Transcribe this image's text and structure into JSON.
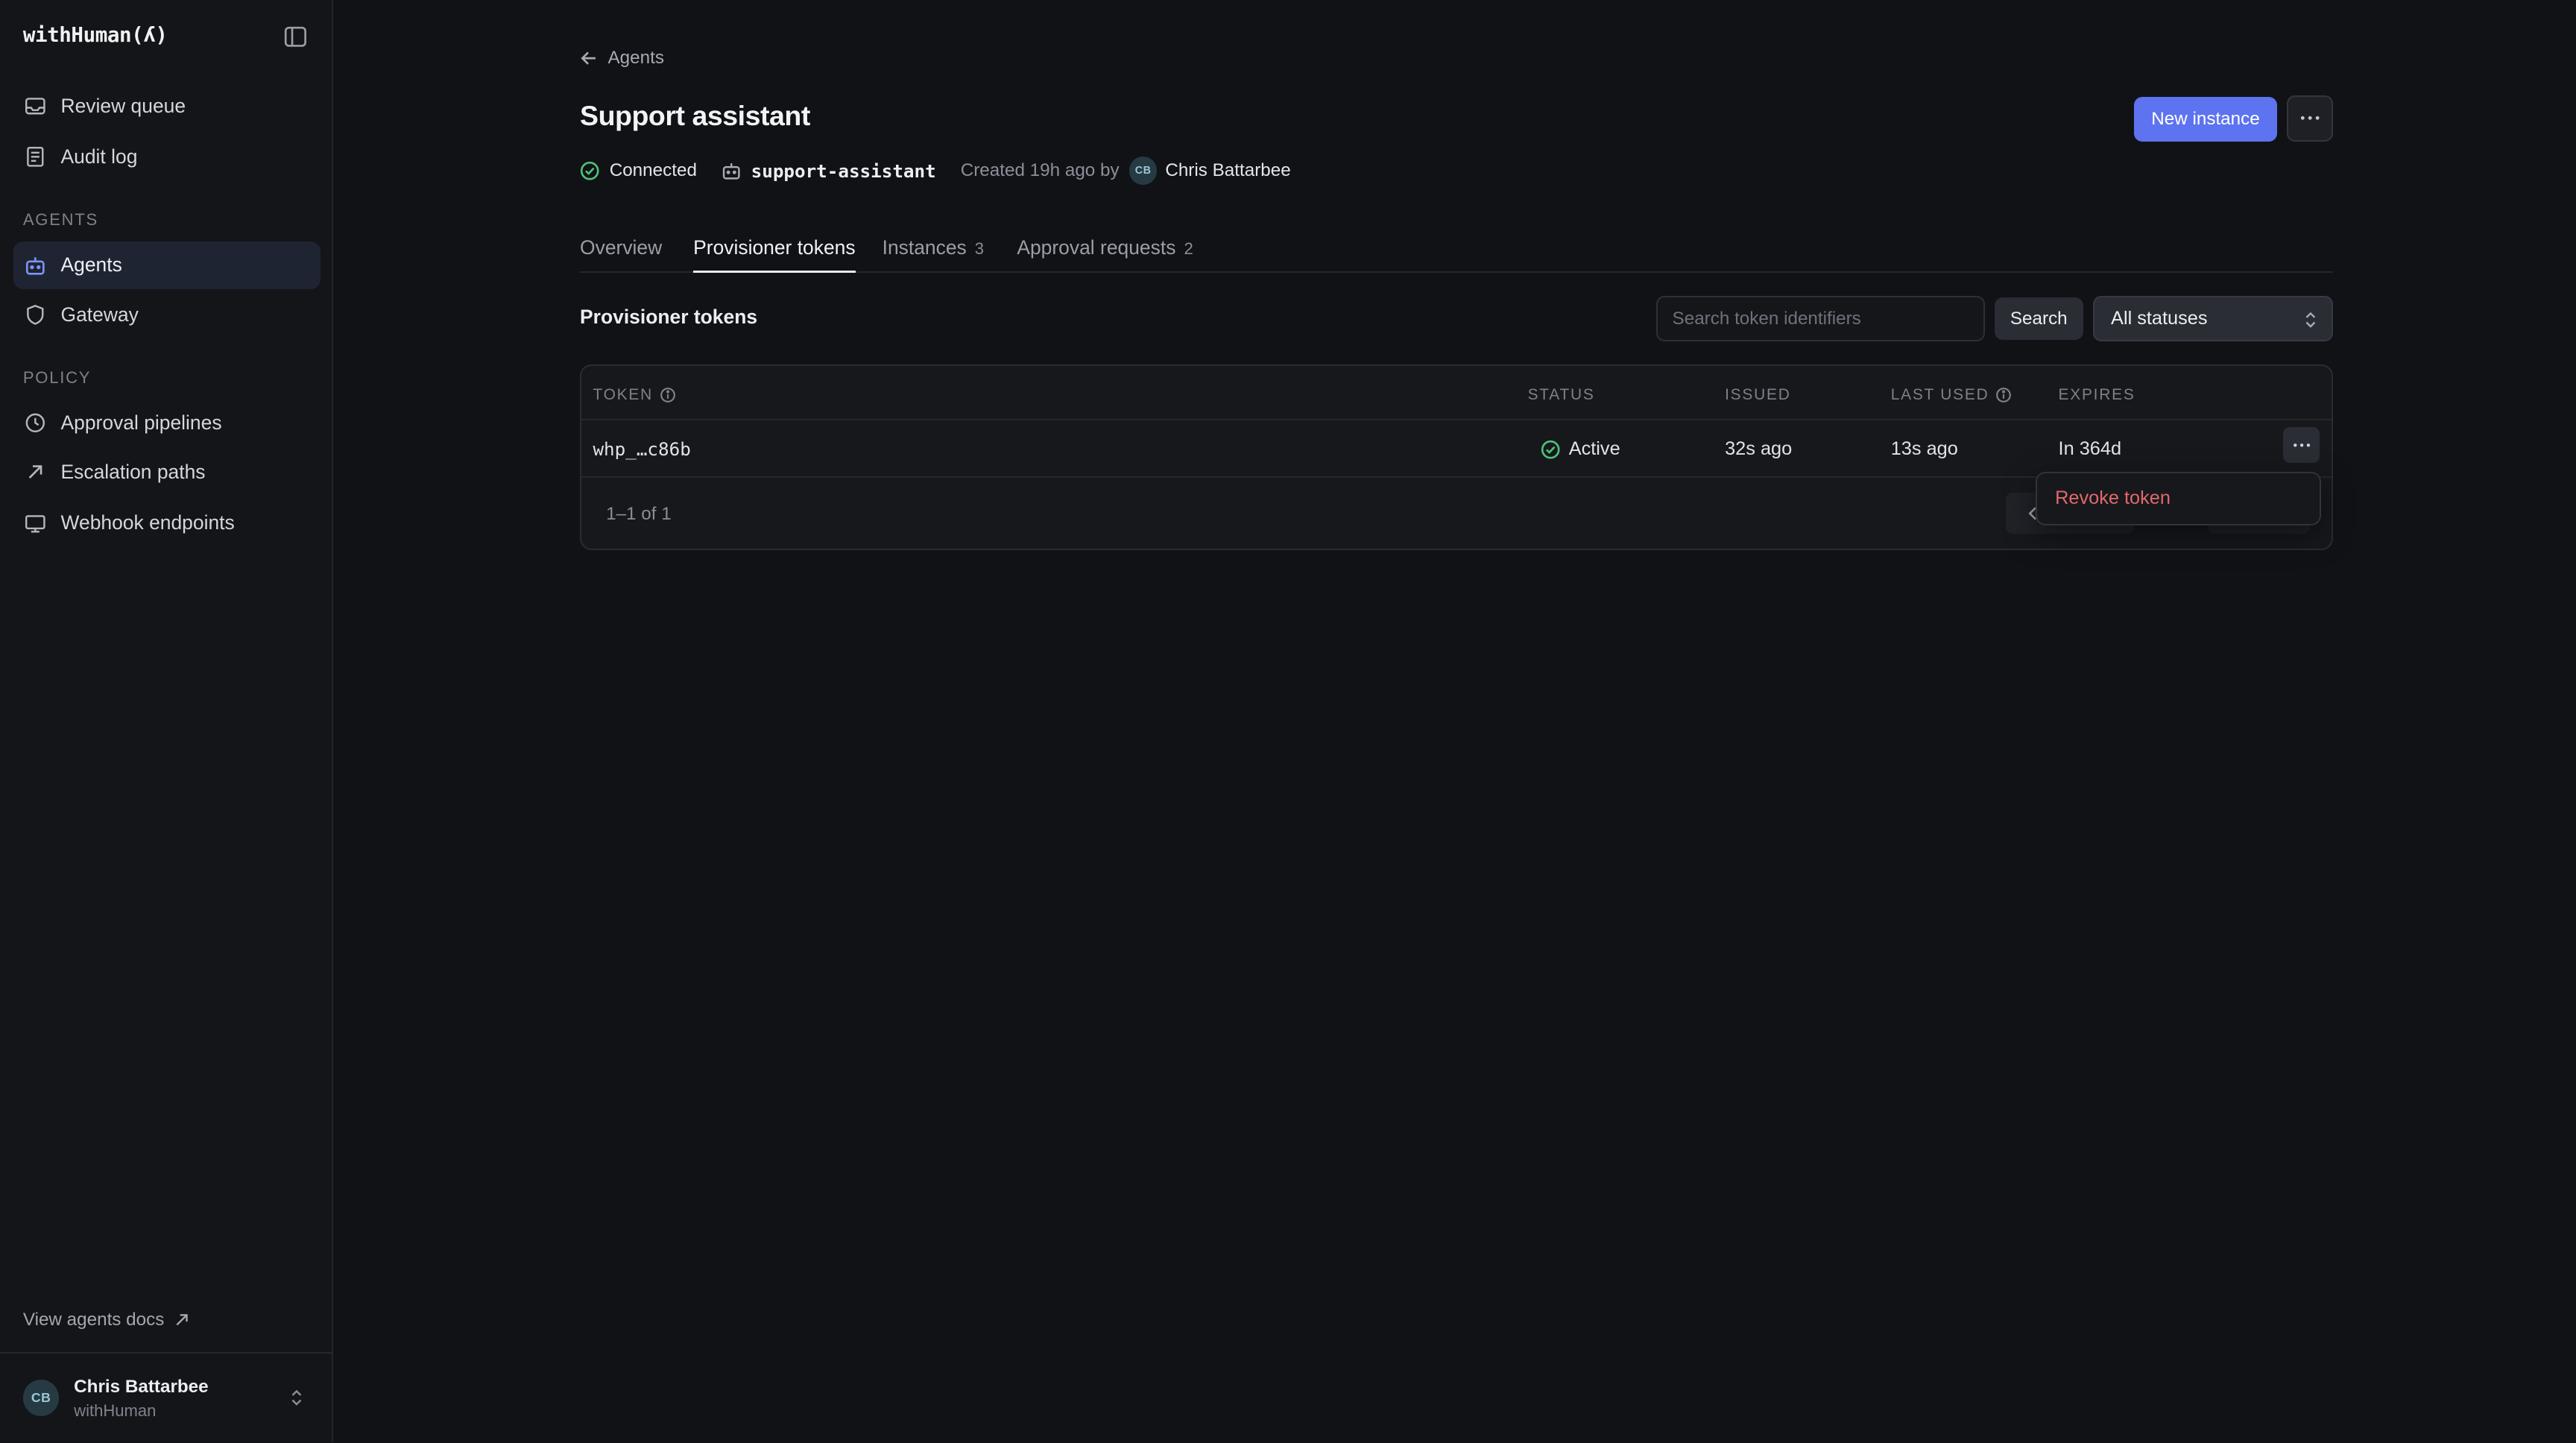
{
  "app": {
    "brand": "withHuman(ʎ)"
  },
  "sidebar": {
    "top_items": [
      {
        "label": "Review queue",
        "icon": "inbox-icon"
      },
      {
        "label": "Audit log",
        "icon": "document-icon"
      }
    ],
    "sections": [
      {
        "label": "AGENTS",
        "items": [
          {
            "label": "Agents",
            "icon": "robot-icon",
            "active": true
          },
          {
            "label": "Gateway",
            "icon": "shield-icon"
          }
        ]
      },
      {
        "label": "POLICY",
        "items": [
          {
            "label": "Approval pipelines",
            "icon": "clock-icon"
          },
          {
            "label": "Escalation paths",
            "icon": "arrow-up-right-icon"
          },
          {
            "label": "Webhook endpoints",
            "icon": "monitor-icon"
          }
        ]
      }
    ],
    "docs_link": "View agents docs",
    "user": {
      "initials": "CB",
      "name": "Chris Battarbee",
      "org": "withHuman"
    }
  },
  "header": {
    "back_label": "Agents",
    "title": "Support assistant",
    "new_instance_label": "New instance",
    "meta": {
      "status": "Connected",
      "slug": "support-assistant",
      "created": "Created 19h ago by",
      "creator_initials": "CB",
      "creator_name": "Chris Battarbee"
    }
  },
  "tabs": [
    {
      "label": "Overview",
      "count": ""
    },
    {
      "label": "Provisioner tokens",
      "count": "",
      "active": true
    },
    {
      "label": "Instances",
      "count": "3"
    },
    {
      "label": "Approval requests",
      "count": "2"
    }
  ],
  "tokens": {
    "section_title": "Provisioner tokens",
    "search_placeholder": "Search token identifiers",
    "search_label": "Search",
    "status_filter": "All statuses",
    "columns": [
      "TOKEN",
      "STATUS",
      "ISSUED",
      "LAST USED",
      "EXPIRES"
    ],
    "rows": [
      {
        "token": "whp_…c86b",
        "status": "Active",
        "issued": "32s ago",
        "last_used": "13s ago",
        "expires": "In 364d"
      }
    ],
    "pagination": "1–1 of 1",
    "menu": {
      "revoke_label": "Revoke token"
    }
  },
  "colors": {
    "accent": "#5d73f0",
    "success": "#4cc27a",
    "danger": "#e0696a"
  }
}
